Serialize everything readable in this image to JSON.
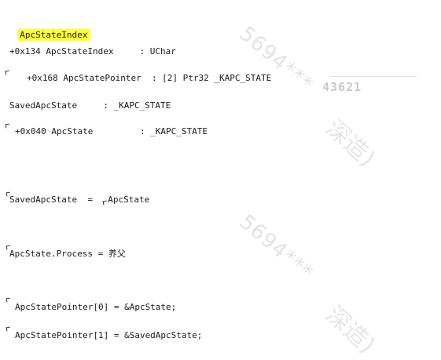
{
  "lines": [
    "ApcStateIndex",
    "+0x134 ApcStateIndex     : UChar",
    "+0x168 ApcStatePointer  : [2] Ptr32 _KAPC_STATE",
    "SavedApcState     : _KAPC_STATE",
    "+0x040 ApcState         : _KAPC_STATE",
    "SavedApcState  =  ",
    "ApcState",
    "ApcState.Process = 养父",
    "ApcStatePointer[0] = &ApcState;",
    "ApcStatePointer[1] = &SavedApcState;"
  ],
  "watermark": {
    "text_a": "5694***",
    "text_b": "深造)",
    "number": "43621"
  }
}
